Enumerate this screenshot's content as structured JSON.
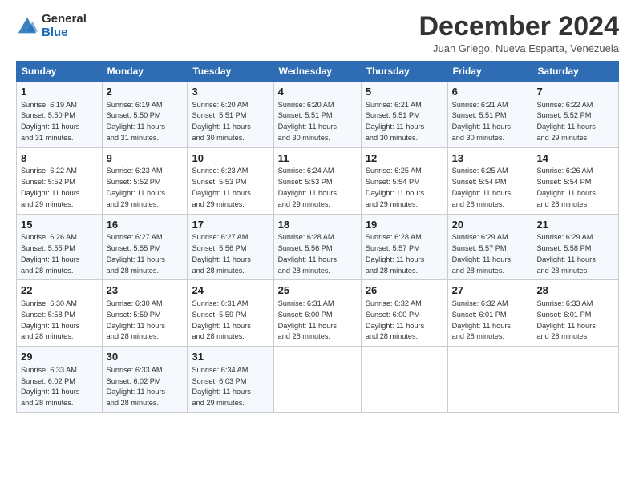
{
  "logo": {
    "general": "General",
    "blue": "Blue"
  },
  "title": "December 2024",
  "location": "Juan Griego, Nueva Esparta, Venezuela",
  "days_of_week": [
    "Sunday",
    "Monday",
    "Tuesday",
    "Wednesday",
    "Thursday",
    "Friday",
    "Saturday"
  ],
  "weeks": [
    [
      {
        "day": "1",
        "info": "Sunrise: 6:19 AM\nSunset: 5:50 PM\nDaylight: 11 hours\nand 31 minutes."
      },
      {
        "day": "2",
        "info": "Sunrise: 6:19 AM\nSunset: 5:50 PM\nDaylight: 11 hours\nand 31 minutes."
      },
      {
        "day": "3",
        "info": "Sunrise: 6:20 AM\nSunset: 5:51 PM\nDaylight: 11 hours\nand 30 minutes."
      },
      {
        "day": "4",
        "info": "Sunrise: 6:20 AM\nSunset: 5:51 PM\nDaylight: 11 hours\nand 30 minutes."
      },
      {
        "day": "5",
        "info": "Sunrise: 6:21 AM\nSunset: 5:51 PM\nDaylight: 11 hours\nand 30 minutes."
      },
      {
        "day": "6",
        "info": "Sunrise: 6:21 AM\nSunset: 5:51 PM\nDaylight: 11 hours\nand 30 minutes."
      },
      {
        "day": "7",
        "info": "Sunrise: 6:22 AM\nSunset: 5:52 PM\nDaylight: 11 hours\nand 29 minutes."
      }
    ],
    [
      {
        "day": "8",
        "info": "Sunrise: 6:22 AM\nSunset: 5:52 PM\nDaylight: 11 hours\nand 29 minutes."
      },
      {
        "day": "9",
        "info": "Sunrise: 6:23 AM\nSunset: 5:52 PM\nDaylight: 11 hours\nand 29 minutes."
      },
      {
        "day": "10",
        "info": "Sunrise: 6:23 AM\nSunset: 5:53 PM\nDaylight: 11 hours\nand 29 minutes."
      },
      {
        "day": "11",
        "info": "Sunrise: 6:24 AM\nSunset: 5:53 PM\nDaylight: 11 hours\nand 29 minutes."
      },
      {
        "day": "12",
        "info": "Sunrise: 6:25 AM\nSunset: 5:54 PM\nDaylight: 11 hours\nand 29 minutes."
      },
      {
        "day": "13",
        "info": "Sunrise: 6:25 AM\nSunset: 5:54 PM\nDaylight: 11 hours\nand 28 minutes."
      },
      {
        "day": "14",
        "info": "Sunrise: 6:26 AM\nSunset: 5:54 PM\nDaylight: 11 hours\nand 28 minutes."
      }
    ],
    [
      {
        "day": "15",
        "info": "Sunrise: 6:26 AM\nSunset: 5:55 PM\nDaylight: 11 hours\nand 28 minutes."
      },
      {
        "day": "16",
        "info": "Sunrise: 6:27 AM\nSunset: 5:55 PM\nDaylight: 11 hours\nand 28 minutes."
      },
      {
        "day": "17",
        "info": "Sunrise: 6:27 AM\nSunset: 5:56 PM\nDaylight: 11 hours\nand 28 minutes."
      },
      {
        "day": "18",
        "info": "Sunrise: 6:28 AM\nSunset: 5:56 PM\nDaylight: 11 hours\nand 28 minutes."
      },
      {
        "day": "19",
        "info": "Sunrise: 6:28 AM\nSunset: 5:57 PM\nDaylight: 11 hours\nand 28 minutes."
      },
      {
        "day": "20",
        "info": "Sunrise: 6:29 AM\nSunset: 5:57 PM\nDaylight: 11 hours\nand 28 minutes."
      },
      {
        "day": "21",
        "info": "Sunrise: 6:29 AM\nSunset: 5:58 PM\nDaylight: 11 hours\nand 28 minutes."
      }
    ],
    [
      {
        "day": "22",
        "info": "Sunrise: 6:30 AM\nSunset: 5:58 PM\nDaylight: 11 hours\nand 28 minutes."
      },
      {
        "day": "23",
        "info": "Sunrise: 6:30 AM\nSunset: 5:59 PM\nDaylight: 11 hours\nand 28 minutes."
      },
      {
        "day": "24",
        "info": "Sunrise: 6:31 AM\nSunset: 5:59 PM\nDaylight: 11 hours\nand 28 minutes."
      },
      {
        "day": "25",
        "info": "Sunrise: 6:31 AM\nSunset: 6:00 PM\nDaylight: 11 hours\nand 28 minutes."
      },
      {
        "day": "26",
        "info": "Sunrise: 6:32 AM\nSunset: 6:00 PM\nDaylight: 11 hours\nand 28 minutes."
      },
      {
        "day": "27",
        "info": "Sunrise: 6:32 AM\nSunset: 6:01 PM\nDaylight: 11 hours\nand 28 minutes."
      },
      {
        "day": "28",
        "info": "Sunrise: 6:33 AM\nSunset: 6:01 PM\nDaylight: 11 hours\nand 28 minutes."
      }
    ],
    [
      {
        "day": "29",
        "info": "Sunrise: 6:33 AM\nSunset: 6:02 PM\nDaylight: 11 hours\nand 28 minutes."
      },
      {
        "day": "30",
        "info": "Sunrise: 6:33 AM\nSunset: 6:02 PM\nDaylight: 11 hours\nand 28 minutes."
      },
      {
        "day": "31",
        "info": "Sunrise: 6:34 AM\nSunset: 6:03 PM\nDaylight: 11 hours\nand 29 minutes."
      },
      {
        "day": "",
        "info": ""
      },
      {
        "day": "",
        "info": ""
      },
      {
        "day": "",
        "info": ""
      },
      {
        "day": "",
        "info": ""
      }
    ]
  ]
}
